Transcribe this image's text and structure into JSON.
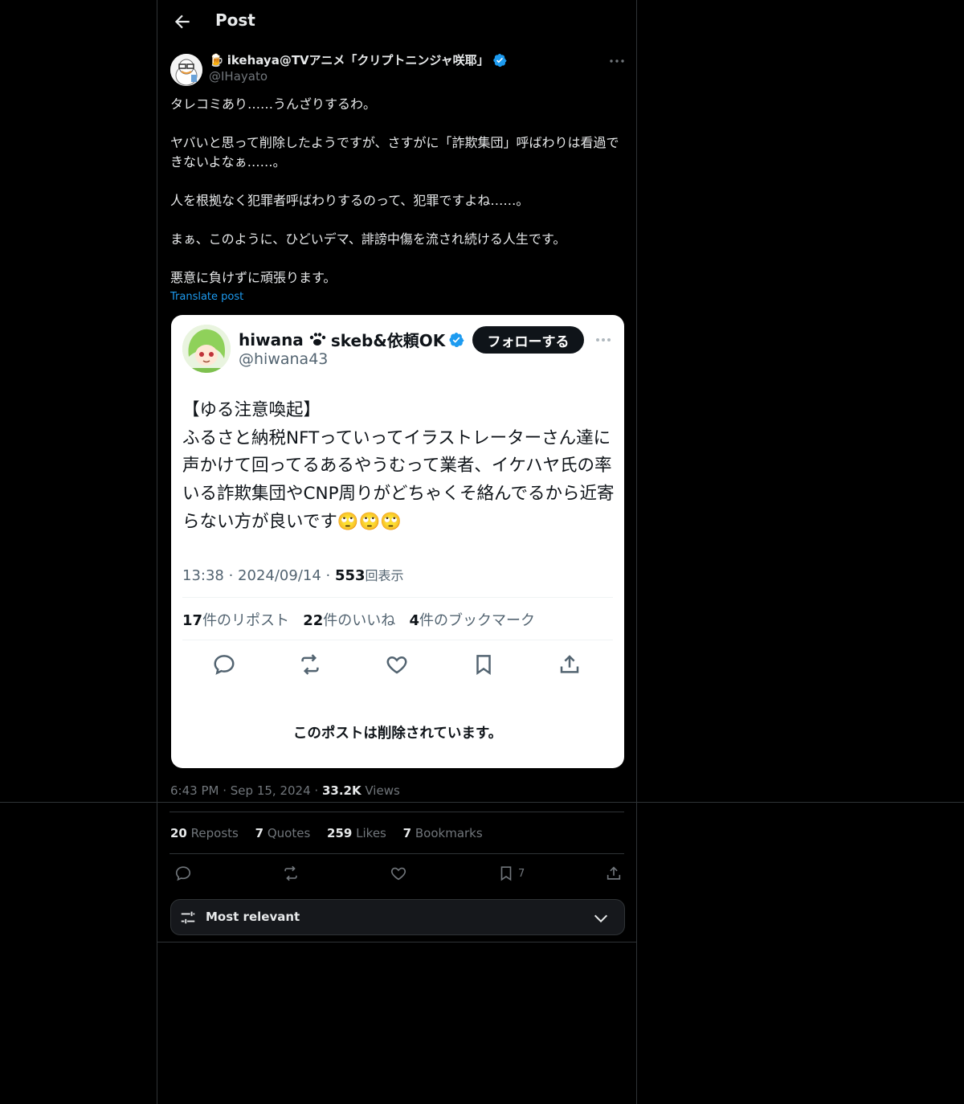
{
  "header": {
    "title": "Post"
  },
  "post": {
    "author_emoji": "🍺",
    "author_name": "ikehaya@TVアニメ「クリプトニンジャ咲耶」",
    "author_handle": "@IHayato",
    "paragraphs": [
      "タレコミあり……うんざりするわ。",
      "ヤバいと思って削除したようですが、さすがに「詐欺集団」呼ばわりは看過できないよなぁ……。",
      "人を根拠なく犯罪者呼ばわりするのって、犯罪ですよね……。",
      "まぁ、このように、ひどいデマ、誹謗中傷を流され続ける人生です。",
      "悪意に負けずに頑張ります。"
    ],
    "translate_label": "Translate post",
    "time": "6:43 PM",
    "date": "Sep 15, 2024",
    "views_count": "33.2K",
    "views_label": "Views",
    "stats": {
      "reposts_count": "20",
      "reposts_label": "Reposts",
      "quotes_count": "7",
      "quotes_label": "Quotes",
      "likes_count": "259",
      "likes_label": "Likes",
      "bookmarks_count": "7",
      "bookmarks_label": "Bookmarks"
    },
    "bookmark_action_count": "7"
  },
  "embedded": {
    "name_a": "hiwana",
    "name_b": "skeb&依頼OK",
    "handle": "@hiwana43",
    "follow_label": "フォローする",
    "text_heading": "【ゆる注意喚起】",
    "text_body": "ふるさと納税NFTっていってイラストレーターさん達に声かけて回ってるあるやうむって業者、イケハヤ氏の率いる詐欺集団やCNP周りがどちゃくそ絡んでるから近寄らない方が良いです",
    "text_emoji": "🙄🙄🙄",
    "time": "13:38",
    "date": "2024/09/14",
    "views_count": "553",
    "views_label": "回表示",
    "reposts_count": "17",
    "reposts_label": "件のリポスト",
    "likes_count": "22",
    "likes_label": "件のいいね",
    "bookmarks_count": "4",
    "bookmarks_label": "件のブックマーク",
    "deleted_notice": "このポストは削除されています。"
  },
  "sort": {
    "label": "Most relevant"
  },
  "colors": {
    "accent": "#1d9bf0",
    "background": "#000000",
    "border": "#2f3336",
    "muted": "#71767b"
  }
}
